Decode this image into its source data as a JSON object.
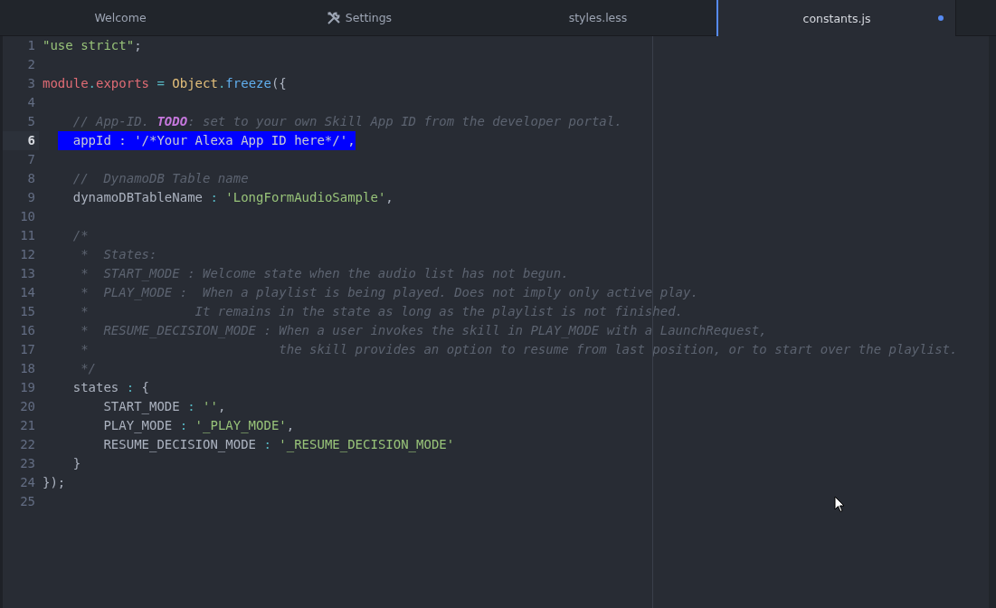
{
  "tabs": [
    {
      "label": "Welcome",
      "kind": "plain",
      "selected": false,
      "modified": false
    },
    {
      "label": "Settings",
      "kind": "settings",
      "selected": false,
      "modified": false
    },
    {
      "label": "styles.less",
      "kind": "plain",
      "selected": false,
      "modified": false
    },
    {
      "label": "constants.js",
      "kind": "plain",
      "selected": true,
      "modified": true
    }
  ],
  "editor": {
    "lines": [
      {
        "number": "1",
        "current": false,
        "selected": false,
        "tokens": [
          {
            "text": "\"use strict\"",
            "kind": "string"
          },
          {
            "text": ";",
            "kind": "plain"
          }
        ]
      },
      {
        "number": "2",
        "current": false,
        "selected": false
      },
      {
        "number": "3",
        "current": false,
        "selected": false,
        "tokens": [
          {
            "text": "module",
            "kind": "keyword"
          },
          {
            "text": ".",
            "kind": "operator"
          },
          {
            "text": "exports",
            "kind": "keyword"
          },
          {
            "text": " = ",
            "kind": "operator"
          },
          {
            "text": "Object",
            "kind": "class"
          },
          {
            "text": ".",
            "kind": "operator"
          },
          {
            "text": "freeze",
            "kind": "function"
          },
          {
            "text": "({",
            "kind": "plain"
          }
        ]
      },
      {
        "number": "4",
        "current": false,
        "selected": false
      },
      {
        "number": "5",
        "current": false,
        "selected": false,
        "tokens": [
          {
            "text": "    // App-ID. ",
            "kind": "comment"
          },
          {
            "text": "TODO",
            "kind": "todo"
          },
          {
            "text": ": set to your own Skill App ID from the developer portal.",
            "kind": "comment"
          }
        ]
      },
      {
        "number": "6",
        "current": true,
        "selected": true,
        "tokens": [
          {
            "text": "    appId",
            "kind": "plain"
          },
          {
            "text": " : ",
            "kind": "plain"
          },
          {
            "text": "'/*Your Alexa App ID here*/'",
            "kind": "plain"
          },
          {
            "text": ",",
            "kind": "plain"
          }
        ]
      },
      {
        "number": "7",
        "current": false,
        "selected": false
      },
      {
        "number": "8",
        "current": false,
        "selected": false,
        "tokens": [
          {
            "text": "    //  DynamoDB Table name",
            "kind": "comment"
          }
        ]
      },
      {
        "number": "9",
        "current": false,
        "selected": false,
        "tokens": [
          {
            "text": "    dynamoDBTableName",
            "kind": "plain"
          },
          {
            "text": " : ",
            "kind": "operator"
          },
          {
            "text": "'LongFormAudioSample'",
            "kind": "string"
          },
          {
            "text": ",",
            "kind": "plain"
          }
        ]
      },
      {
        "number": "10",
        "current": false,
        "selected": false
      },
      {
        "number": "11",
        "current": false,
        "selected": false,
        "tokens": [
          {
            "text": "    /*",
            "kind": "comment"
          }
        ]
      },
      {
        "number": "12",
        "current": false,
        "selected": false,
        "tokens": [
          {
            "text": "     *  States:",
            "kind": "comment"
          }
        ]
      },
      {
        "number": "13",
        "current": false,
        "selected": false,
        "tokens": [
          {
            "text": "     *  START_MODE : Welcome state when the audio list has not begun.",
            "kind": "comment"
          }
        ]
      },
      {
        "number": "14",
        "current": false,
        "selected": false,
        "tokens": [
          {
            "text": "     *  PLAY_MODE :  When a playlist is being played. Does not imply only active play.",
            "kind": "comment"
          }
        ]
      },
      {
        "number": "15",
        "current": false,
        "selected": false,
        "tokens": [
          {
            "text": "     *              It remains in the state as long as the playlist is not finished.",
            "kind": "comment"
          }
        ]
      },
      {
        "number": "16",
        "current": false,
        "selected": false,
        "tokens": [
          {
            "text": "     *  RESUME_DECISION_MODE : When a user invokes the skill in PLAY_MODE with a LaunchRequest,",
            "kind": "comment"
          }
        ]
      },
      {
        "number": "17",
        "current": false,
        "selected": false,
        "tokens": [
          {
            "text": "     *                         the skill provides an option to resume from last position, or to start over the playlist.",
            "kind": "comment"
          }
        ]
      },
      {
        "number": "18",
        "current": false,
        "selected": false,
        "tokens": [
          {
            "text": "     */",
            "kind": "comment"
          }
        ]
      },
      {
        "number": "19",
        "current": false,
        "selected": false,
        "tokens": [
          {
            "text": "    states",
            "kind": "plain"
          },
          {
            "text": " : ",
            "kind": "operator"
          },
          {
            "text": "{",
            "kind": "plain"
          }
        ]
      },
      {
        "number": "20",
        "current": false,
        "selected": false,
        "tokens": [
          {
            "text": "        START_MODE",
            "kind": "plain"
          },
          {
            "text": " : ",
            "kind": "operator"
          },
          {
            "text": "''",
            "kind": "string"
          },
          {
            "text": ",",
            "kind": "plain"
          }
        ]
      },
      {
        "number": "21",
        "current": false,
        "selected": false,
        "tokens": [
          {
            "text": "        PLAY_MODE",
            "kind": "plain"
          },
          {
            "text": " : ",
            "kind": "operator"
          },
          {
            "text": "'_PLAY_MODE'",
            "kind": "string"
          },
          {
            "text": ",",
            "kind": "plain"
          }
        ]
      },
      {
        "number": "22",
        "current": false,
        "selected": false,
        "tokens": [
          {
            "text": "        RESUME_DECISION_MODE",
            "kind": "plain"
          },
          {
            "text": " : ",
            "kind": "operator"
          },
          {
            "text": "'_RESUME_DECISION_MODE'",
            "kind": "string"
          }
        ]
      },
      {
        "number": "23",
        "current": false,
        "selected": false,
        "tokens": [
          {
            "text": "    }",
            "kind": "plain"
          }
        ]
      },
      {
        "number": "24",
        "current": false,
        "selected": false,
        "tokens": [
          {
            "text": "});",
            "kind": "plain"
          }
        ]
      },
      {
        "number": "25",
        "current": false,
        "selected": false
      }
    ]
  }
}
